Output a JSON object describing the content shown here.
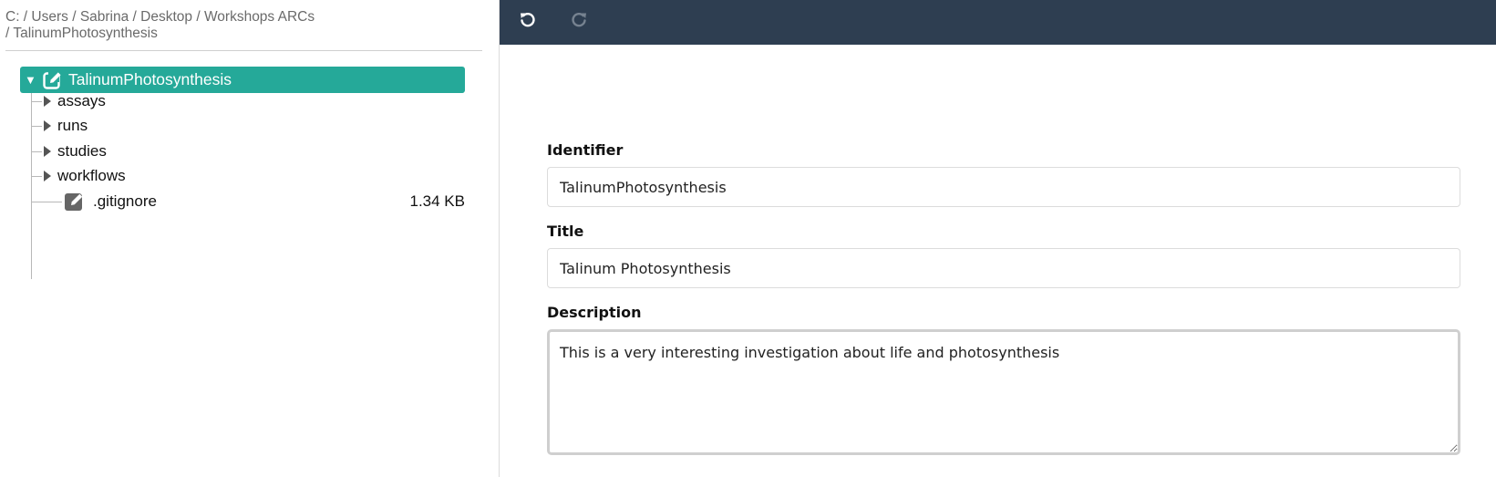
{
  "breadcrumb": {
    "line1": "C: / Users / Sabrina / Desktop / Workshops ARCs",
    "line2": "/ TalinumPhotosynthesis"
  },
  "tree": {
    "root": {
      "label": "TalinumPhotosynthesis",
      "icon": "edit-icon"
    },
    "folders": [
      {
        "label": "assays"
      },
      {
        "label": "runs"
      },
      {
        "label": "studies"
      },
      {
        "label": "workflows"
      }
    ],
    "files": [
      {
        "label": ".gitignore",
        "size": "1.34 KB",
        "icon": "edit-icon"
      }
    ]
  },
  "toolbar": {
    "undo_icon": "undo-icon",
    "redo_icon": "redo-icon"
  },
  "form": {
    "identifier": {
      "label": "Identifier",
      "value": "TalinumPhotosynthesis"
    },
    "title": {
      "label": "Title",
      "value": "Talinum Photosynthesis"
    },
    "description": {
      "label": "Description",
      "value": "This is a very interesting investigation about life and photosynthesis"
    }
  },
  "colors": {
    "selected_row": "#25a999",
    "toolbar_bg": "#2e3e51"
  }
}
